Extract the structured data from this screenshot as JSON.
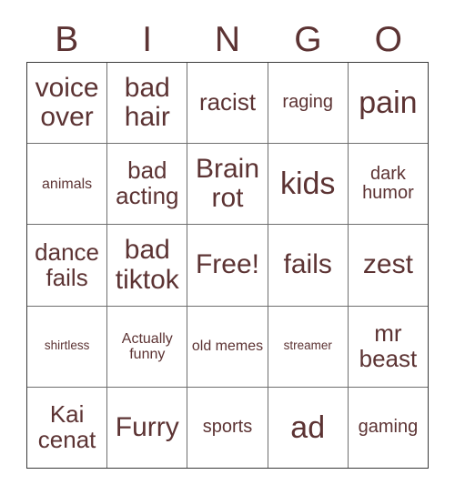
{
  "card": {
    "title": "BINGO",
    "text_color": "#5C3333",
    "background_color": "#FFFFFF",
    "grid_line_color": "#6E6E6E",
    "outer_border_color": "#3A3A3A",
    "columns": 5,
    "rows": 5
  },
  "header": {
    "letters": [
      "B",
      "I",
      "N",
      "G",
      "O"
    ]
  },
  "grid": {
    "rows": [
      {
        "cells": [
          {
            "label": "voice over",
            "size": "lg"
          },
          {
            "label": "bad hair",
            "size": "lg"
          },
          {
            "label": "racist",
            "size": "md"
          },
          {
            "label": "raging",
            "size": "sm"
          },
          {
            "label": "pain",
            "size": "xl"
          }
        ]
      },
      {
        "cells": [
          {
            "label": "animals",
            "size": "xs"
          },
          {
            "label": "bad acting",
            "size": "md"
          },
          {
            "label": "Brain rot",
            "size": "lg"
          },
          {
            "label": "kids",
            "size": "xl"
          },
          {
            "label": "dark humor",
            "size": "sm"
          }
        ]
      },
      {
        "cells": [
          {
            "label": "dance fails",
            "size": "md"
          },
          {
            "label": "bad tiktok",
            "size": "lg"
          },
          {
            "label": "Free!",
            "size": "lg"
          },
          {
            "label": "fails",
            "size": "lg"
          },
          {
            "label": "zest",
            "size": "lg"
          }
        ]
      },
      {
        "cells": [
          {
            "label": "shirtless",
            "size": "xxs"
          },
          {
            "label": "Actually funny",
            "size": "xs"
          },
          {
            "label": "old memes",
            "size": "xs"
          },
          {
            "label": "streamer",
            "size": "xxs"
          },
          {
            "label": "mr beast",
            "size": "md"
          }
        ]
      },
      {
        "cells": [
          {
            "label": "Kai cenat",
            "size": "md"
          },
          {
            "label": "Furry",
            "size": "lg"
          },
          {
            "label": "sports",
            "size": "sm"
          },
          {
            "label": "ad",
            "size": "xl"
          },
          {
            "label": "gaming",
            "size": "sm"
          }
        ]
      }
    ]
  }
}
